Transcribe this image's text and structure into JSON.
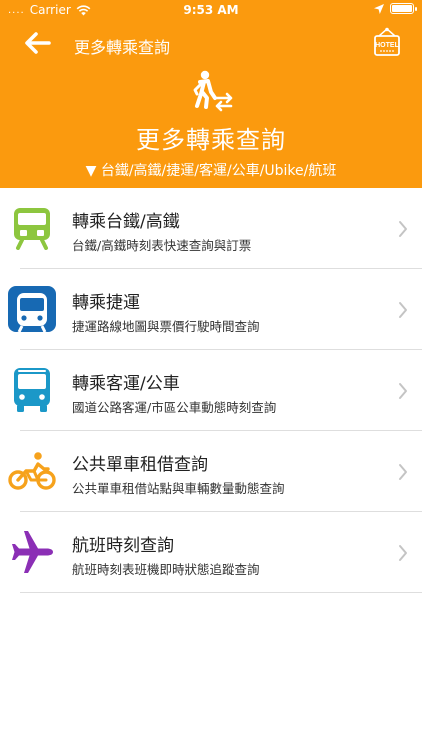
{
  "statusbar": {
    "dots": "....",
    "carrier": "Carrier",
    "time": "9:53 AM"
  },
  "nav": {
    "title": "更多轉乘查詢",
    "back_icon": "arrow-left-icon",
    "hotel_icon": "hotel-sign-icon",
    "hotel_icon_text": "HOTEL"
  },
  "hero": {
    "icon": "pedestrian-transfer-icon",
    "title": "更多轉乘查詢",
    "subtitle": "▼ 台鐵/高鐵/捷運/客運/公車/Ubike/航班"
  },
  "colors": {
    "header_bg": "#fb9a0e",
    "rail_icon": "#8dc63f",
    "mrt_icon": "#1769b3",
    "bus_icon": "#1b98c8",
    "bike_icon": "#f6a21c",
    "flight_icon": "#8b2fb5"
  },
  "items": [
    {
      "icon": "train-icon",
      "title": "轉乘台鐵/高鐵",
      "desc": "台鐵/高鐵時刻表快速查詢與訂票"
    },
    {
      "icon": "metro-icon",
      "title": "轉乘捷運",
      "desc": "捷運路線地圖與票價行駛時間查詢"
    },
    {
      "icon": "bus-icon",
      "title": "轉乘客運/公車",
      "desc": "國道公路客運/市區公車動態時刻查詢"
    },
    {
      "icon": "bicycle-icon",
      "title": "公共單車租借查詢",
      "desc": "公共單車租借站點與車輛數量動態查詢"
    },
    {
      "icon": "airplane-icon",
      "title": "航班時刻查詢",
      "desc": "航班時刻表班機即時狀態追蹤查詢"
    }
  ]
}
